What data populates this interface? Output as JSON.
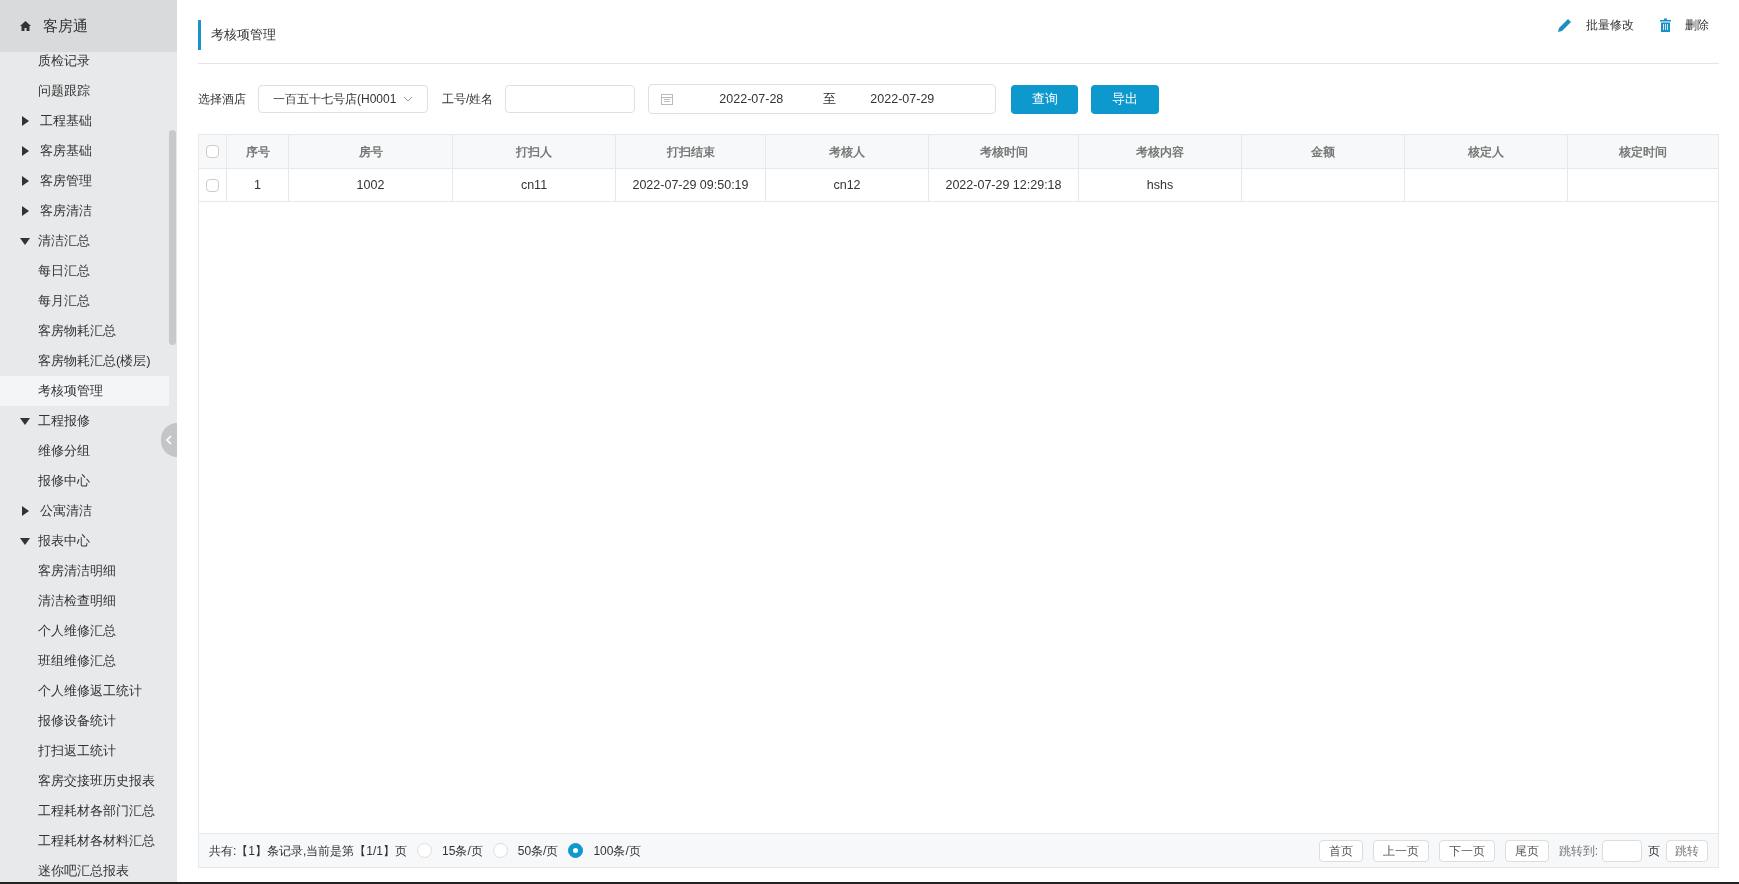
{
  "app": {
    "title": "客房通"
  },
  "sidebar": {
    "items": [
      {
        "label": "质检记录",
        "selected": false
      },
      {
        "label": "问题跟踪",
        "selected": false
      },
      {
        "kind": "group",
        "label": "工程基础",
        "expanded": false
      },
      {
        "kind": "group",
        "label": "客房基础",
        "expanded": false
      },
      {
        "kind": "group",
        "label": "客房管理",
        "expanded": false
      },
      {
        "kind": "group",
        "label": "客房清洁",
        "expanded": false
      },
      {
        "kind": "group",
        "label": "清洁汇总",
        "expanded": true,
        "children": [
          {
            "label": "每日汇总",
            "selected": false
          },
          {
            "label": "每月汇总",
            "selected": false
          },
          {
            "label": "客房物耗汇总",
            "selected": false
          },
          {
            "label": "客房物耗汇总(楼层)",
            "selected": false
          },
          {
            "label": "考核项管理",
            "selected": true
          }
        ]
      },
      {
        "kind": "group",
        "label": "工程报修",
        "expanded": true,
        "children": [
          {
            "label": "维修分组",
            "selected": false
          },
          {
            "label": "报修中心",
            "selected": false
          }
        ]
      },
      {
        "kind": "group",
        "label": "公寓清洁",
        "expanded": false
      },
      {
        "kind": "group",
        "label": "报表中心",
        "expanded": true,
        "children": [
          {
            "label": "客房清洁明细",
            "selected": false
          },
          {
            "label": "清洁检查明细",
            "selected": false
          },
          {
            "label": "个人维修汇总",
            "selected": false
          },
          {
            "label": "班组维修汇总",
            "selected": false
          },
          {
            "label": "个人维修返工统计",
            "selected": false
          },
          {
            "label": "报修设备统计",
            "selected": false
          },
          {
            "label": "打扫返工统计",
            "selected": false
          },
          {
            "label": "客房交接班历史报表",
            "selected": false
          },
          {
            "label": "工程耗材各部门汇总",
            "selected": false
          },
          {
            "label": "工程耗材各材料汇总",
            "selected": false
          },
          {
            "label": "迷你吧汇总报表",
            "selected": false
          }
        ]
      }
    ]
  },
  "page_title": "考核项管理",
  "actions": [
    {
      "kind": "edit",
      "label": "批量修改"
    },
    {
      "kind": "delete",
      "label": "删除"
    }
  ],
  "filters": {
    "hotel_label": "选择酒店",
    "hotel_value": "一百五十七号店(H0001",
    "staff_label": "工号/姓名",
    "date_from": "2022-07-28",
    "date_sep": "至",
    "date_to": "2022-07-29",
    "query_button": "查询",
    "export_button": "导出"
  },
  "table": {
    "all_checked": false,
    "columns": [
      "序号",
      "房号",
      "打扫人",
      "打扫结束",
      "考核人",
      "考核时间",
      "考核内容",
      "金额",
      "核定人",
      "核定时间"
    ],
    "rows": [
      {
        "checked": false,
        "cells": [
          "1",
          "1002",
          "cn11",
          "2022-07-29 09:50:19",
          "cn12",
          "2022-07-29 12:29:18",
          "hshs",
          "",
          "",
          ""
        ]
      }
    ]
  },
  "pager": {
    "summary": "共有:【1】条记录,当前是第【1/1】页",
    "sizes": [
      {
        "label": "15条/页",
        "selected": false
      },
      {
        "label": "50条/页",
        "selected": false
      },
      {
        "label": "100条/页",
        "selected": true
      }
    ],
    "buttons": [
      "首页",
      "上一页",
      "下一页",
      "尾页"
    ],
    "jump_label": "跳转到:",
    "page_unit": "页",
    "jump_button": "跳转"
  }
}
